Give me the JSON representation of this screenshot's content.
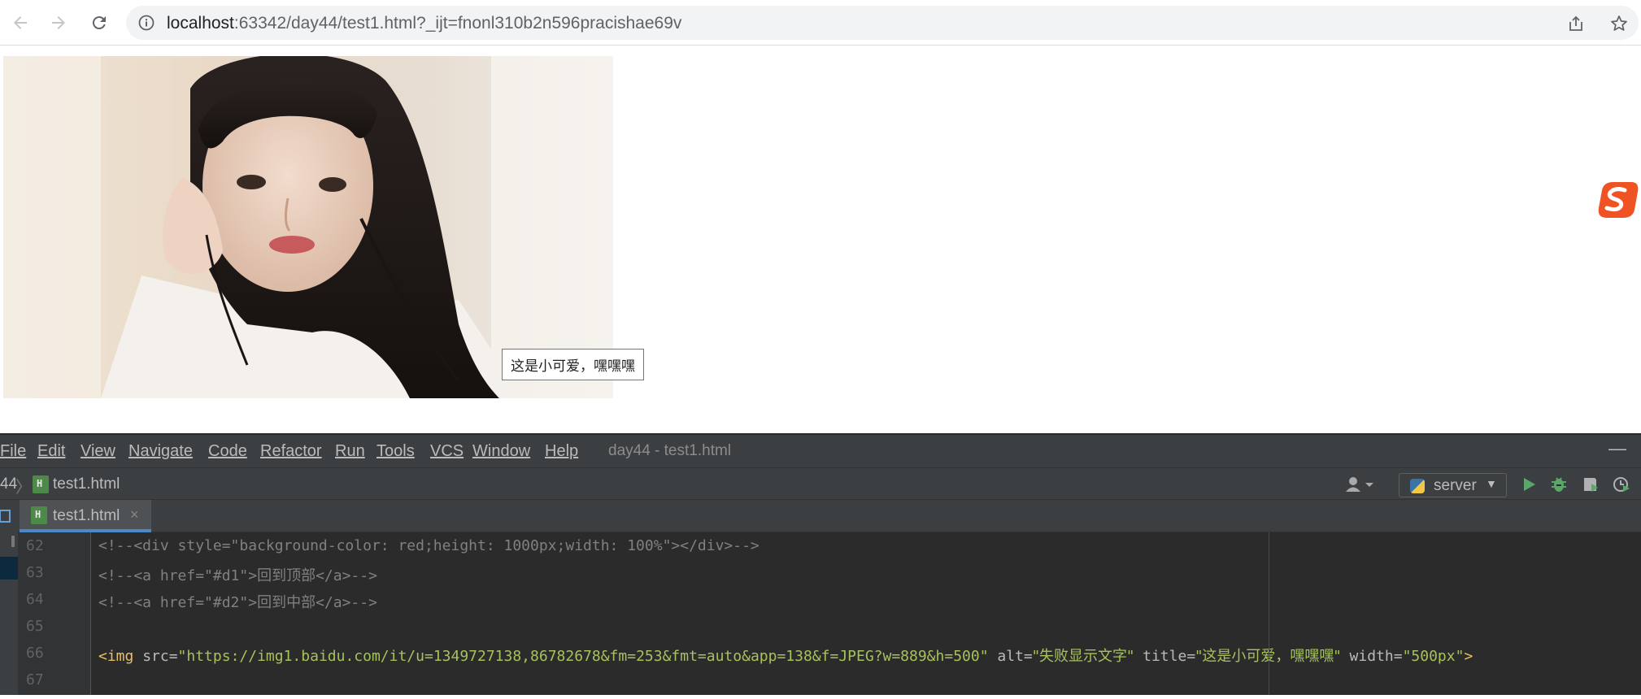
{
  "browser": {
    "url_host": "localhost",
    "url_path": ":63342/day44/test1.html?_ijt=fnonl310b2n596pracishae69v",
    "icons": [
      "back-arrow-icon",
      "forward-arrow-icon",
      "reload-icon",
      "info-icon",
      "share-icon",
      "star-icon"
    ]
  },
  "page": {
    "tooltip": "这是小可爱，嘿嘿嘿",
    "photo_icon": "portrait-photo",
    "floating_icon": "sogou-ime-icon"
  },
  "ide": {
    "menu": [
      "File",
      "Edit",
      "View",
      "Navigate",
      "Code",
      "Refactor",
      "Run",
      "Tools",
      "VCS",
      "Window",
      "Help"
    ],
    "window_title": "day44 - test1.html",
    "minimize": "—",
    "breadcrumb_root": "44",
    "breadcrumb_file": "test1.html",
    "run_config": "server",
    "tab_label": "test1.html",
    "tab_close": "×",
    "line_numbers": [
      "62",
      "63",
      "64",
      "65",
      "66",
      "67"
    ],
    "code": {
      "l62": "<!--<div style=\"background-color: red;height: 1000px;width: 100%\"></div>-->",
      "l63a": "<!--<a href=\"#d1\">",
      "l63b": "回到顶部",
      "l63c": "</a>-->",
      "l64a": "<!--<a href=\"#d2\">",
      "l64b": "回到中部",
      "l64c": "</a>-->",
      "l66_tag": "<img ",
      "l66_src_attr": "src=",
      "l66_src_val": "\"https://img1.baidu.com/it/u=1349727138,86782678&fm=253&fmt=auto&app=138&f=JPEG?w=889&h=500\"",
      "l66_alt_attr": " alt=",
      "l66_alt_val": "\"失败显示文字\"",
      "l66_title_attr": " title=",
      "l66_title_val": "\"这是小可爱，嘿嘿嘿\"",
      "l66_width_attr": " width=",
      "l66_width_val": "\"500px\"",
      "l66_close": ">"
    }
  }
}
